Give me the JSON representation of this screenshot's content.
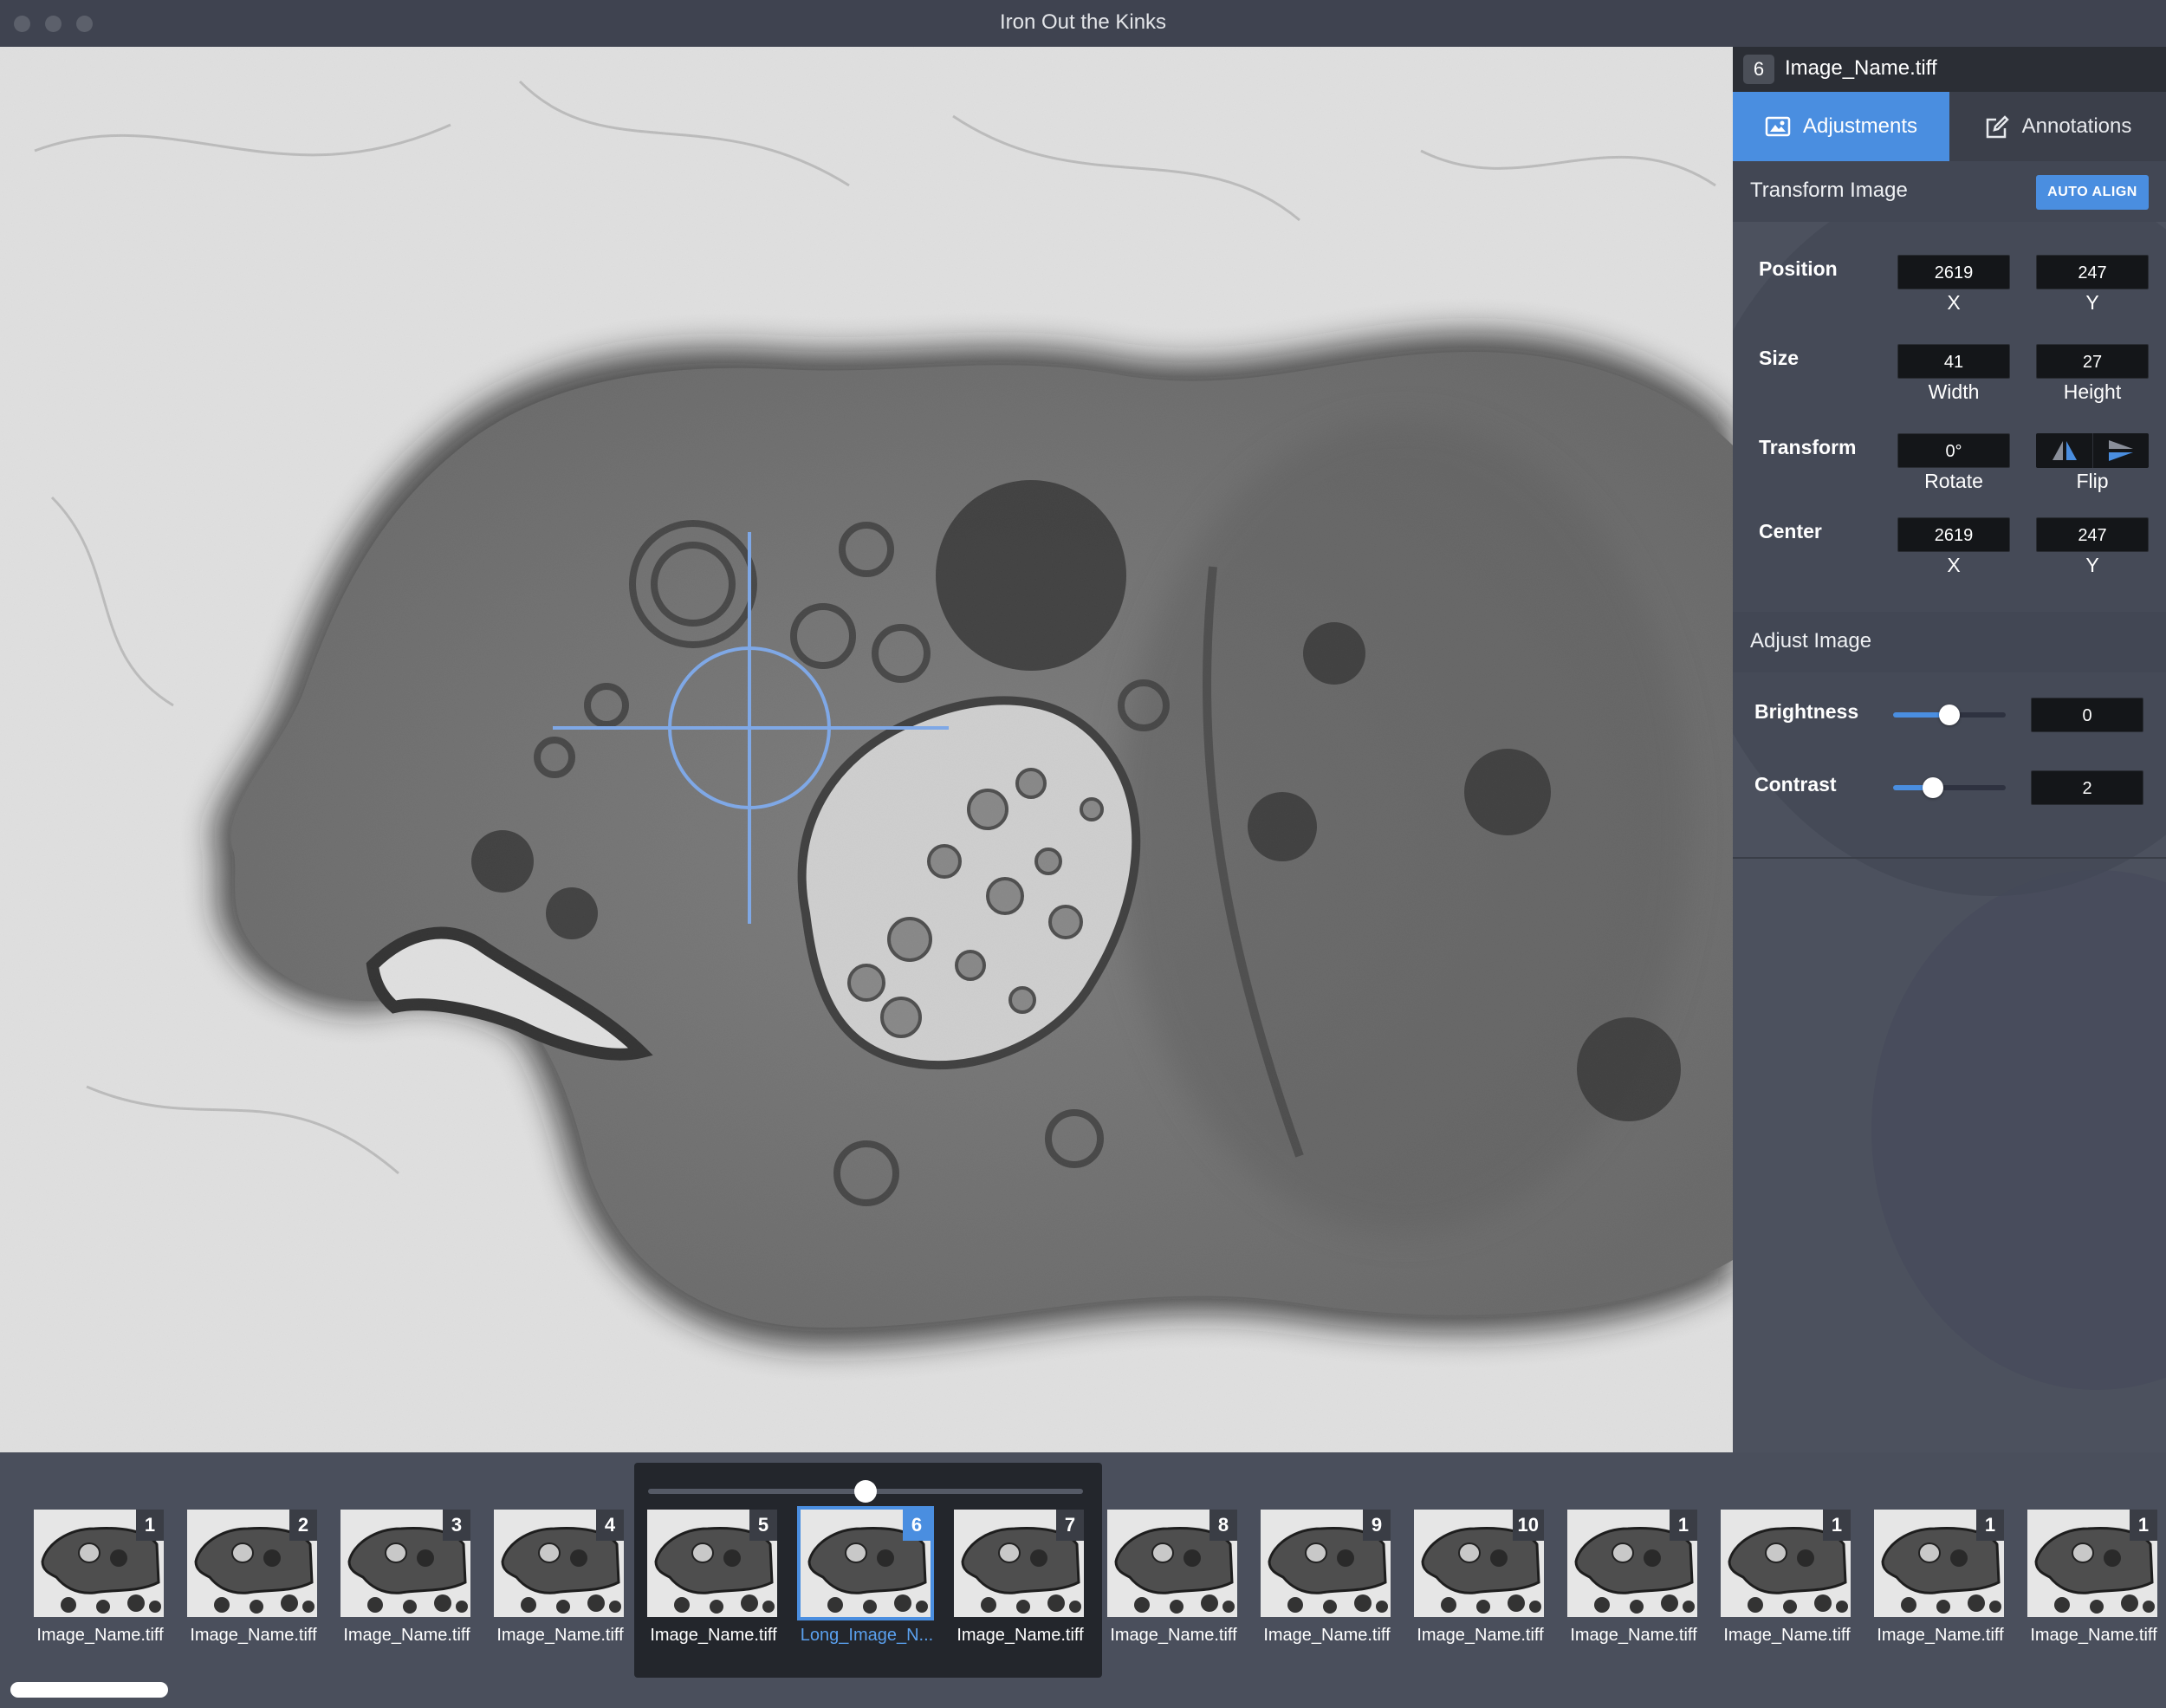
{
  "window": {
    "title": "Iron Out the Kinks"
  },
  "file": {
    "index": "6",
    "name": "Image_Name.tiff"
  },
  "tabs": [
    {
      "label": "Adjustments",
      "icon": "image-icon",
      "active": true
    },
    {
      "label": "Annotations",
      "icon": "edit-icon",
      "active": false
    }
  ],
  "transform": {
    "title": "Transform Image",
    "auto_align_label": "AUTO ALIGN",
    "position": {
      "label": "Position",
      "x": "2619",
      "y": "247",
      "x_label": "X",
      "y_label": "Y"
    },
    "size": {
      "label": "Size",
      "width": "41",
      "height": "27",
      "width_label": "Width",
      "height_label": "Height"
    },
    "transform": {
      "label": "Transform",
      "rotate": "0°",
      "rotate_label": "Rotate",
      "flip_label": "Flip"
    },
    "center": {
      "label": "Center",
      "x": "2619",
      "y": "247",
      "x_label": "X",
      "y_label": "Y"
    }
  },
  "adjust": {
    "title": "Adjust Image",
    "brightness": {
      "label": "Brightness",
      "value": "0",
      "level": 0.5
    },
    "contrast": {
      "label": "Contrast",
      "value": "2",
      "level": 0.35
    }
  },
  "filmstrip": {
    "zoom_level": 0.5,
    "selected_index": 5,
    "thumbs": [
      {
        "num": "1",
        "label": "Image_Name.tiff"
      },
      {
        "num": "2",
        "label": "Image_Name.tiff"
      },
      {
        "num": "3",
        "label": "Image_Name.tiff"
      },
      {
        "num": "4",
        "label": "Image_Name.tiff"
      },
      {
        "num": "5",
        "label": "Image_Name.tiff"
      },
      {
        "num": "6",
        "label": "Long_Image_N..."
      },
      {
        "num": "7",
        "label": "Image_Name.tiff"
      },
      {
        "num": "8",
        "label": "Image_Name.tiff"
      },
      {
        "num": "9",
        "label": "Image_Name.tiff"
      },
      {
        "num": "10",
        "label": "Image_Name.tiff"
      },
      {
        "num": "1",
        "label": "Image_Name.tiff"
      },
      {
        "num": "1",
        "label": "Image_Name.tiff"
      },
      {
        "num": "1",
        "label": "Image_Name.tiff"
      },
      {
        "num": "1",
        "label": "Image_Name.tiff"
      }
    ]
  },
  "colors": {
    "accent": "#4a8ee0",
    "panel": "#4c515e",
    "titlebar": "#3f4350",
    "field": "#141619"
  }
}
